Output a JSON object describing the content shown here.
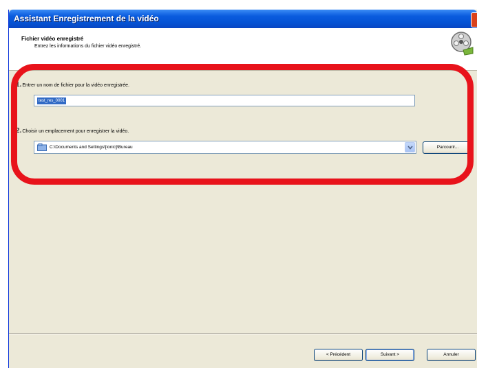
{
  "window": {
    "title": "Assistant Enregistrement de la vidéo"
  },
  "header": {
    "title": "Fichier vidéo enregistré",
    "subtitle": "Entrez les informations du fichier vidéo enregistré."
  },
  "step1": {
    "number": "1.",
    "label": "Entrer un nom de fichier pour la vidéo enregistrée.",
    "value": "test_res_0001"
  },
  "step2": {
    "number": "2.",
    "label": "Choisir un emplacement pour enregistrer la vidéo.",
    "value": "C:\\Documents and Settings\\[ionic]\\Bureau",
    "browse_label": "Parcourir..."
  },
  "footer": {
    "prev_label": "< Précédent",
    "next_label": "Suivant >",
    "cancel_label": "Annuler"
  },
  "colors": {
    "highlight": "#e8131b",
    "titlebar": "#0553d4",
    "dialog_bg": "#ece9d8"
  },
  "icons": [
    "close-icon",
    "film-reel-icon",
    "folder-icon",
    "chevron-down-icon"
  ]
}
